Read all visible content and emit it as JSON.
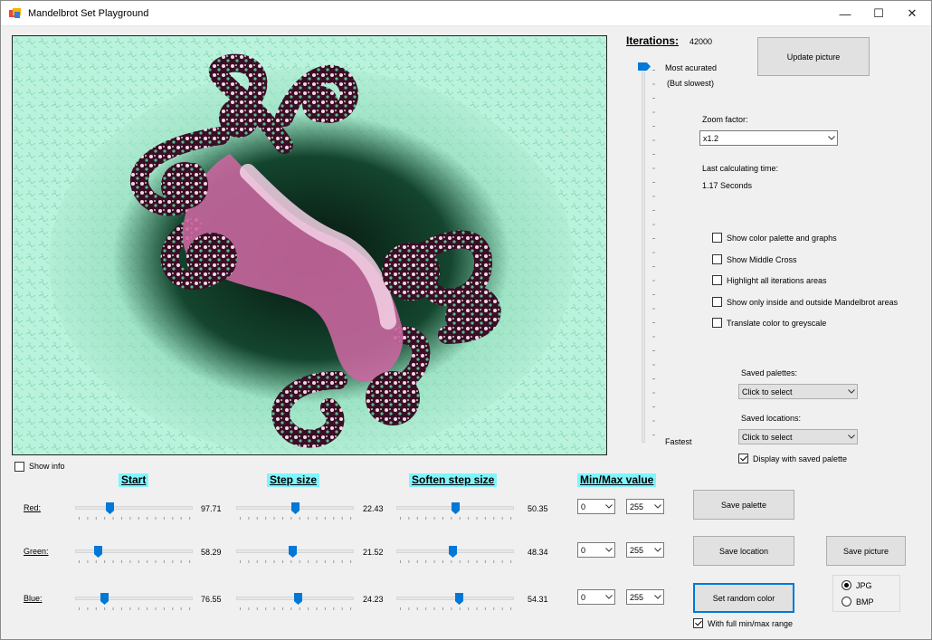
{
  "window": {
    "title": "Mandelbrot Set Playground"
  },
  "title_buttons": {
    "minimize": "—",
    "maximize": "☐",
    "close": "✕"
  },
  "iterations": {
    "label": "Iterations:",
    "value": "42000",
    "top_label": "Most acurated",
    "top_sub": "(But slowest)",
    "bottom_label": "Fastest",
    "slider_level": 1.0
  },
  "update_button": "Update picture",
  "zoom": {
    "label": "Zoom factor:",
    "value": "x1.2"
  },
  "calc_time": {
    "label": "Last calculating time:",
    "value": "1.17 Seconds"
  },
  "options": [
    {
      "label": "Show color palette and graphs",
      "checked": false
    },
    {
      "label": "Show Middle Cross",
      "checked": false
    },
    {
      "label": "Highlight all iterations areas",
      "checked": false
    },
    {
      "label": "Show only inside and outside Mandelbrot areas",
      "checked": false
    },
    {
      "label": "Translate color to greyscale",
      "checked": false
    }
  ],
  "saved_palettes": {
    "label": "Saved palettes:",
    "value": "Click to select"
  },
  "saved_locations": {
    "label": "Saved locations:",
    "value": "Click to select"
  },
  "display_with_palette": {
    "label": "Display with saved palette",
    "checked": true
  },
  "show_info": {
    "label": "Show info",
    "checked": false
  },
  "headers": {
    "start": "Start",
    "step": "Step size",
    "soften": "Soften step size",
    "minmax": "Min/Max value"
  },
  "rows": [
    {
      "label": "Red:",
      "start": {
        "value": "97.71",
        "level": 0.28
      },
      "step": {
        "value": "22.43",
        "level": 0.5
      },
      "soften": {
        "value": "50.35",
        "level": 0.5
      },
      "min": "0",
      "max": "255"
    },
    {
      "label": "Green:",
      "start": {
        "value": "58.29",
        "level": 0.17
      },
      "step": {
        "value": "21.52",
        "level": 0.48
      },
      "soften": {
        "value": "48.34",
        "level": 0.48
      },
      "min": "0",
      "max": "255"
    },
    {
      "label": "Blue:",
      "start": {
        "value": "76.55",
        "level": 0.23
      },
      "step": {
        "value": "24.23",
        "level": 0.53
      },
      "soften": {
        "value": "54.31",
        "level": 0.54
      },
      "min": "0",
      "max": "255"
    }
  ],
  "buttons": {
    "save_palette": "Save  palette",
    "save_location": "Save location",
    "save_picture": "Save picture",
    "set_random_color": "Set random color"
  },
  "full_range": {
    "label": "With full min/max range",
    "checked": true
  },
  "formats": [
    {
      "label": "JPG",
      "checked": true
    },
    {
      "label": "BMP",
      "checked": false
    }
  ],
  "colors": {
    "accent": "#0078d7",
    "header_bg": "#7ff5ff",
    "fractal_light": "#aef0d8",
    "fractal_dark": "#0c3a26",
    "fractal_pink": "#c8679e"
  }
}
